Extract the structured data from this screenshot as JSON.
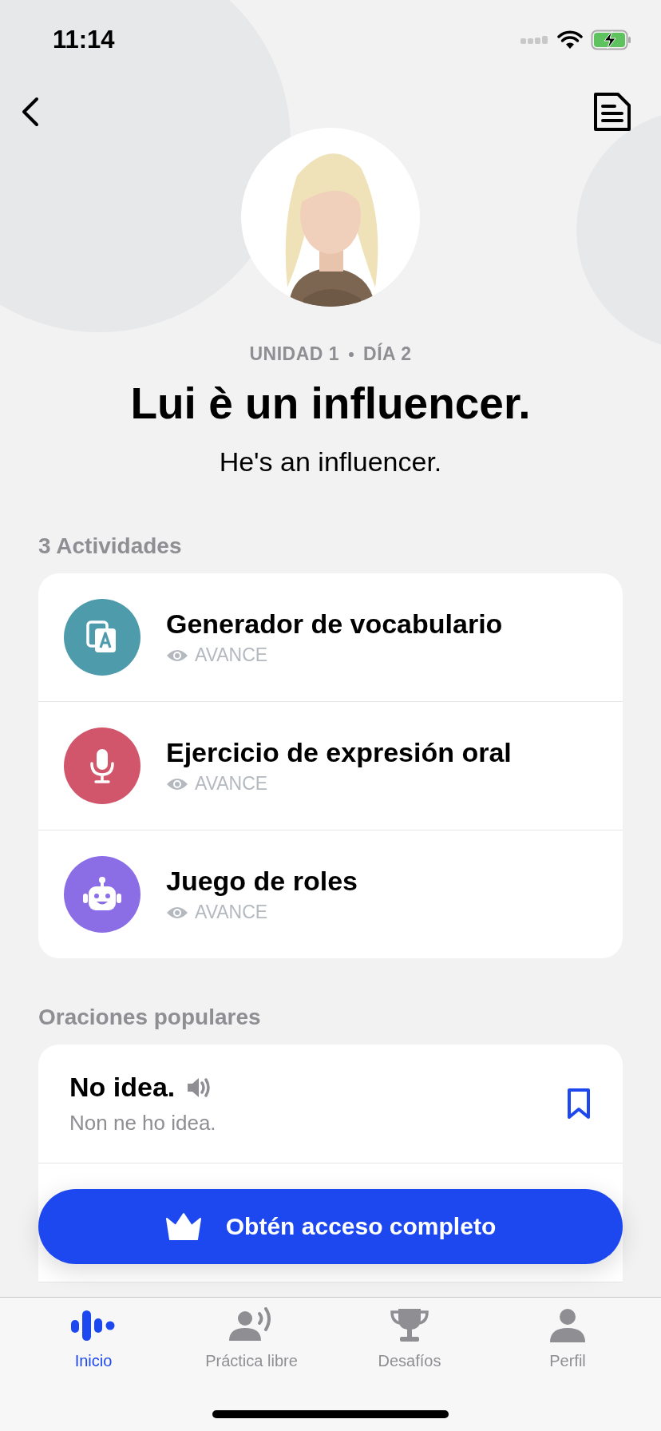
{
  "status_bar": {
    "time": "11:14"
  },
  "lesson": {
    "unit": "UNIDAD 1",
    "day": "DÍA 2",
    "title": "Lui è un influencer.",
    "translation": "He's an influencer."
  },
  "activities": {
    "heading": "3 Actividades",
    "items": [
      {
        "kind": "vocabulary",
        "title": "Generador de vocabulario",
        "status": "AVANCE",
        "color": "#4e9bac"
      },
      {
        "kind": "speaking",
        "title": "Ejercicio de expresión oral",
        "status": "AVANCE",
        "color": "#d2566b"
      },
      {
        "kind": "roleplay",
        "title": "Juego de roles",
        "status": "AVANCE",
        "color": "#8b6ee6"
      }
    ]
  },
  "sentences": {
    "heading": "Oraciones populares",
    "items": [
      {
        "text": "No idea.",
        "translation": "Non ne ho idea.",
        "bookmarked": false
      }
    ]
  },
  "cta": {
    "label": "Obtén acceso completo"
  },
  "tab_bar": [
    {
      "kind": "home",
      "label": "Inicio",
      "selected": true
    },
    {
      "kind": "practice",
      "label": "Práctica libre",
      "selected": false
    },
    {
      "kind": "challenges",
      "label": "Desafíos",
      "selected": false
    },
    {
      "kind": "profile",
      "label": "Perfil",
      "selected": false
    }
  ]
}
